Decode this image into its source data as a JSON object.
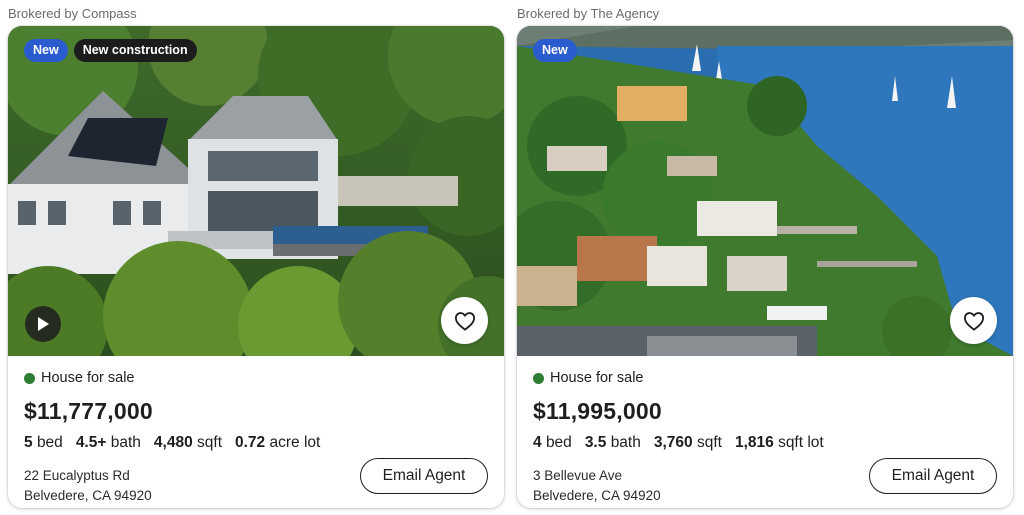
{
  "listings": [
    {
      "broker": "Brokered by Compass",
      "badges": [
        "New",
        "New construction"
      ],
      "status": "House for sale",
      "price": "$11,777,000",
      "specs": {
        "beds": {
          "value": "5",
          "unit": "bed"
        },
        "baths": {
          "value": "4.5+",
          "unit": "bath"
        },
        "sqft": {
          "value": "4,480",
          "unit": "sqft"
        },
        "lot": {
          "value": "0.72",
          "unit": "acre lot"
        }
      },
      "address_line1": "22 Eucalyptus Rd",
      "address_line2": "Belvedere, CA 94920",
      "email_label": "Email Agent",
      "has_video": true
    },
    {
      "broker": "Brokered by The Agency",
      "badges": [
        "New"
      ],
      "status": "House for sale",
      "price": "$11,995,000",
      "specs": {
        "beds": {
          "value": "4",
          "unit": "bed"
        },
        "baths": {
          "value": "3.5",
          "unit": "bath"
        },
        "sqft": {
          "value": "3,760",
          "unit": "sqft"
        },
        "lot": {
          "value": "1,816",
          "unit": "sqft lot"
        }
      },
      "address_line1": "3 Bellevue Ave",
      "address_line2": "Belvedere, CA 94920",
      "email_label": "Email Agent",
      "has_video": false
    }
  ],
  "icons": {
    "play": "play-icon",
    "favorite": "heart-outline-icon"
  },
  "colors": {
    "new_badge": "#2b5ccf",
    "construction_badge": "#1c1c1c",
    "status_dot": "#2f7d32"
  }
}
